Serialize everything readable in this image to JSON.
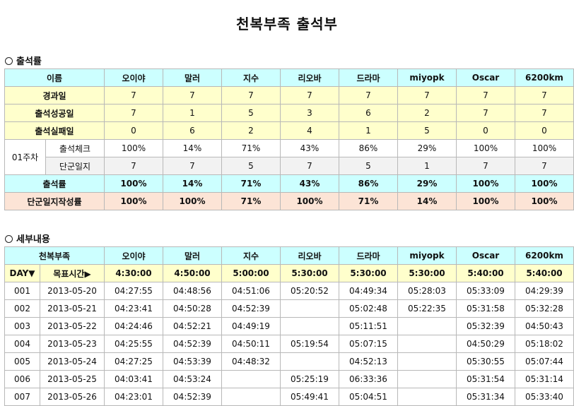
{
  "title": "천복부족 출석부",
  "section1_label": "출석률",
  "section2_label": "세부내용",
  "members": [
    "오이야",
    "말러",
    "지수",
    "리오바",
    "드라마",
    "miyopk",
    "Oscar",
    "6200km"
  ],
  "summary": {
    "name_header": "이름",
    "elapsed_label": "경과일",
    "elapsed": [
      "7",
      "7",
      "7",
      "7",
      "7",
      "7",
      "7",
      "7"
    ],
    "success_label": "출석성공일",
    "success": [
      "7",
      "1",
      "5",
      "3",
      "6",
      "2",
      "7",
      "7"
    ],
    "fail_label": "출석실패일",
    "fail": [
      "0",
      "6",
      "2",
      "4",
      "1",
      "5",
      "0",
      "0"
    ],
    "week_label": "01주차",
    "check_label": "출석체크",
    "check": [
      "100%",
      "14%",
      "71%",
      "43%",
      "86%",
      "29%",
      "100%",
      "100%"
    ],
    "diary_label": "단군일지",
    "diary": [
      "7",
      "7",
      "5",
      "7",
      "5",
      "1",
      "7",
      "7"
    ],
    "rate_label": "출석률",
    "rate": [
      "100%",
      "14%",
      "71%",
      "43%",
      "86%",
      "29%",
      "100%",
      "100%"
    ],
    "diary_rate_label": "단군일지작성률",
    "diary_rate": [
      "100%",
      "100%",
      "71%",
      "100%",
      "71%",
      "14%",
      "100%",
      "100%"
    ]
  },
  "detail": {
    "tribe_header": "천복부족",
    "day_label": "DAY▼",
    "target_label": "목표시간▶",
    "targets": [
      "4:30:00",
      "4:50:00",
      "5:00:00",
      "5:30:00",
      "5:30:00",
      "5:30:00",
      "5:40:00",
      "5:40:00"
    ],
    "rows": [
      {
        "day": "001",
        "date": "2013-05-20",
        "times": [
          "04:27:55",
          "04:48:56",
          "05:20:52",
          "04:49:34",
          "05:28:03",
          "05:33:09",
          "04:29:39"
        ]
      },
      {
        "day": "002",
        "date": "2013-05-21",
        "times": [
          "04:23:41",
          "04:50:28",
          "04:52:39",
          "",
          "05:02:48",
          "05:22:35",
          "05:31:58",
          "05:32:28"
        ]
      },
      {
        "day": "003",
        "date": "2013-05-22",
        "times": [
          "04:24:46",
          "04:52:21",
          "04:49:19",
          "",
          "05:11:51",
          "",
          "05:32:39",
          "04:50:43"
        ]
      },
      {
        "day": "004",
        "date": "2013-05-23",
        "times": [
          "04:25:55",
          "04:52:39",
          "04:50:11",
          "05:19:54",
          "05:07:15",
          "",
          "04:50:29",
          "05:18:02"
        ]
      },
      {
        "day": "005",
        "date": "2013-05-24",
        "times": [
          "04:27:25",
          "04:53:39",
          "04:48:32",
          "",
          "04:52:13",
          "",
          "05:30:55",
          "05:07:44"
        ]
      },
      {
        "day": "006",
        "date": "2013-05-25",
        "times": [
          "04:03:41",
          "04:53:24",
          "",
          "05:25:19",
          "06:33:36",
          "",
          "05:31:54",
          "05:31:14"
        ]
      },
      {
        "day": "007",
        "date": "2013-05-26",
        "times": [
          "04:23:01",
          "04:52:39",
          "",
          "05:49:41",
          "05:04:51",
          "",
          "05:31:34",
          "05:33:40"
        ]
      }
    ]
  }
}
